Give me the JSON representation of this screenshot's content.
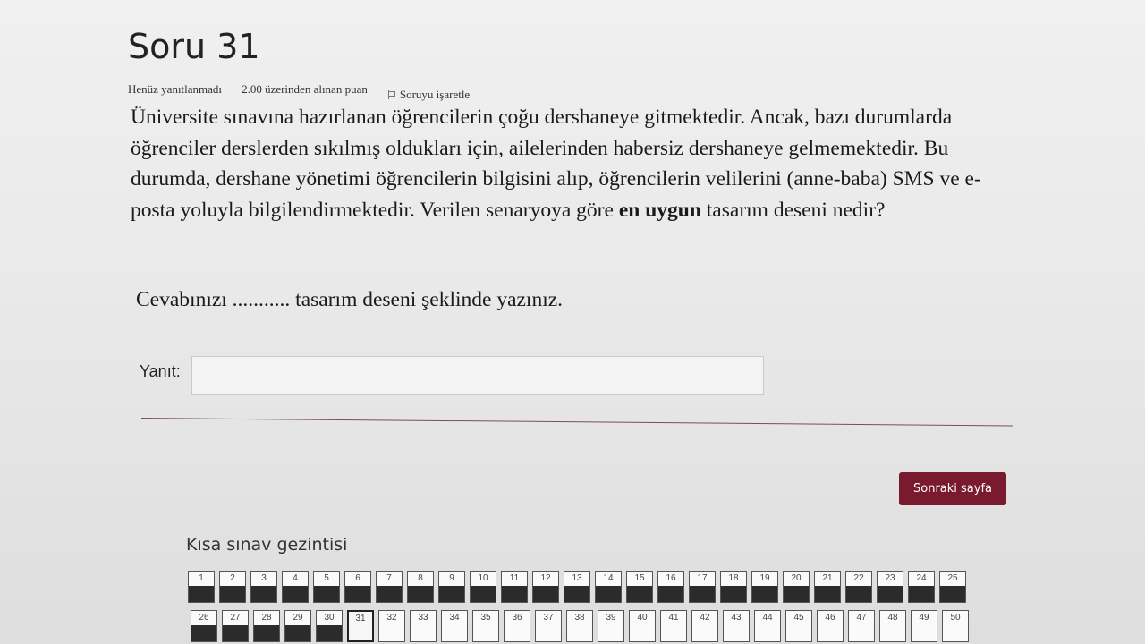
{
  "question": {
    "title": "Soru 31",
    "status": "Henüz yanıtlanmadı",
    "points": "2.00 üzerinden alınan puan",
    "flag_label": "Soruyu işaretle",
    "text_before": "Üniversite sınavına hazırlanan öğrencilerin çoğu dershaneye gitmektedir. Ancak, bazı durumlarda öğrenciler derslerden sıkılmış oldukları için, ailelerinden habersiz dershaneye gelmemektedir. Bu durumda, dershane yönetimi öğrencilerin bilgisini alıp, öğrencilerin velilerini (anne-baba) SMS ve e-posta yoluyla bilgilendirmektedir. Verilen senaryoya göre ",
    "text_bold": "en uygun",
    "text_after": " tasarım deseni nedir?",
    "instruction": "Cevabınızı ........... tasarım deseni şeklinde yazınız."
  },
  "answer": {
    "label": "Yanıt:",
    "value": ""
  },
  "next_button": "Sonraki sayfa",
  "quiz_nav": {
    "title": "Kısa sınav gezintisi",
    "current": "31",
    "row1": [
      {
        "n": "1",
        "state": "answered"
      },
      {
        "n": "2",
        "state": "answered"
      },
      {
        "n": "3",
        "state": "answered"
      },
      {
        "n": "4",
        "state": "answered"
      },
      {
        "n": "5",
        "state": "answered"
      },
      {
        "n": "6",
        "state": "answered"
      },
      {
        "n": "7",
        "state": "answered"
      },
      {
        "n": "8",
        "state": "answered"
      },
      {
        "n": "9",
        "state": "answered"
      },
      {
        "n": "10",
        "state": "answered"
      },
      {
        "n": "11",
        "state": "answered"
      },
      {
        "n": "12",
        "state": "answered"
      },
      {
        "n": "13",
        "state": "answered"
      },
      {
        "n": "14",
        "state": "answered"
      },
      {
        "n": "15",
        "state": "answered"
      },
      {
        "n": "16",
        "state": "answered"
      },
      {
        "n": "17",
        "state": "answered"
      },
      {
        "n": "18",
        "state": "answered"
      },
      {
        "n": "19",
        "state": "answered"
      },
      {
        "n": "20",
        "state": "answered"
      },
      {
        "n": "21",
        "state": "answered"
      },
      {
        "n": "22",
        "state": "answered"
      },
      {
        "n": "23",
        "state": "answered"
      },
      {
        "n": "24",
        "state": "answered"
      },
      {
        "n": "25",
        "state": "answered"
      }
    ],
    "row2": [
      {
        "n": "26",
        "state": "answered"
      },
      {
        "n": "27",
        "state": "answered"
      },
      {
        "n": "28",
        "state": "answered"
      },
      {
        "n": "29",
        "state": "answered"
      },
      {
        "n": "30",
        "state": "answered"
      },
      {
        "n": "31",
        "state": "current"
      },
      {
        "n": "32",
        "state": "unanswered"
      },
      {
        "n": "33",
        "state": "unanswered"
      },
      {
        "n": "34",
        "state": "unanswered"
      },
      {
        "n": "35",
        "state": "unanswered"
      },
      {
        "n": "36",
        "state": "unanswered"
      },
      {
        "n": "37",
        "state": "unanswered"
      },
      {
        "n": "38",
        "state": "unanswered"
      },
      {
        "n": "39",
        "state": "unanswered"
      },
      {
        "n": "40",
        "state": "unanswered"
      },
      {
        "n": "41",
        "state": "unanswered"
      },
      {
        "n": "42",
        "state": "unanswered"
      },
      {
        "n": "43",
        "state": "unanswered"
      },
      {
        "n": "44",
        "state": "unanswered"
      },
      {
        "n": "45",
        "state": "unanswered"
      },
      {
        "n": "46",
        "state": "unanswered"
      },
      {
        "n": "47",
        "state": "unanswered"
      },
      {
        "n": "48",
        "state": "unanswered"
      },
      {
        "n": "49",
        "state": "unanswered"
      },
      {
        "n": "50",
        "state": "unanswered"
      }
    ]
  },
  "colors": {
    "accent": "#7a1a2e",
    "answered_bar": "#2b2b2b"
  }
}
